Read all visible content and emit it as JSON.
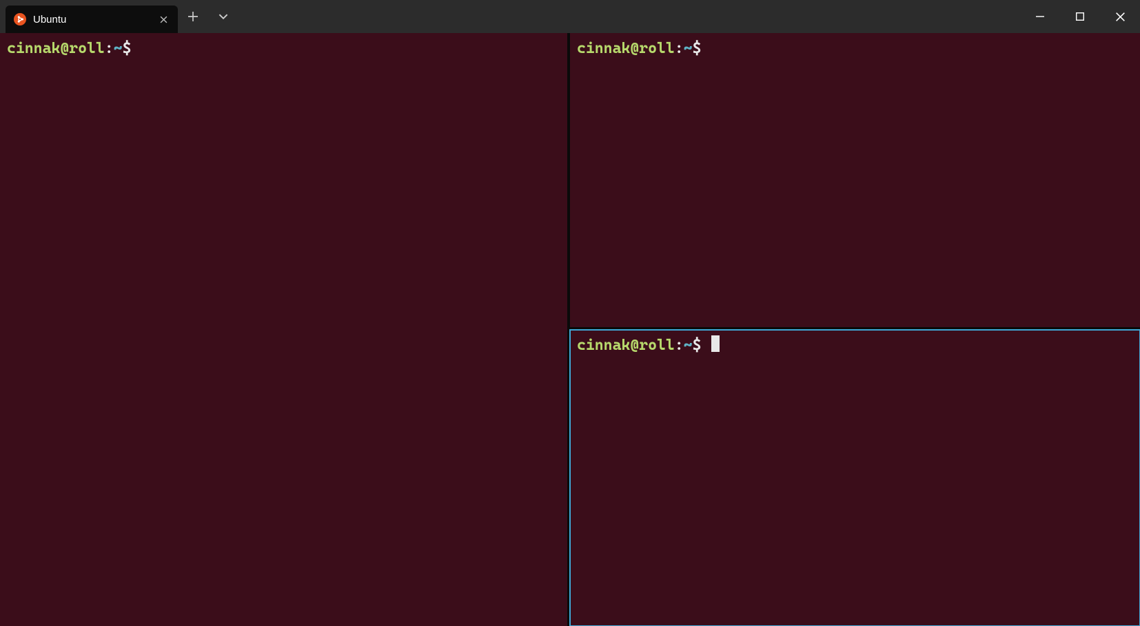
{
  "titlebar": {
    "tabs": [
      {
        "label": "Ubuntu",
        "icon": "ubuntu-icon"
      }
    ],
    "new_tab_tooltip": "New tab",
    "dropdown_tooltip": "Open a new tab dropdown"
  },
  "window_controls": {
    "minimize": "Minimize",
    "maximize": "Maximize",
    "close": "Close"
  },
  "panes": {
    "left": {
      "prompt_user": "cinnak@roll",
      "prompt_sep": ":",
      "prompt_path": "~",
      "prompt_symbol": "$"
    },
    "topright": {
      "prompt_user": "cinnak@roll",
      "prompt_sep": ":",
      "prompt_path": "~",
      "prompt_symbol": "$"
    },
    "bottomright": {
      "prompt_user": "cinnak@roll",
      "prompt_sep": ":",
      "prompt_path": "~",
      "prompt_symbol": "$",
      "active": true
    }
  },
  "colors": {
    "pane_bg": "#3b0d1a",
    "active_border": "#3fa8d6",
    "prompt_user": "#b7d96c",
    "prompt_path": "#5fb3c6",
    "ubuntu_accent": "#e95420"
  }
}
